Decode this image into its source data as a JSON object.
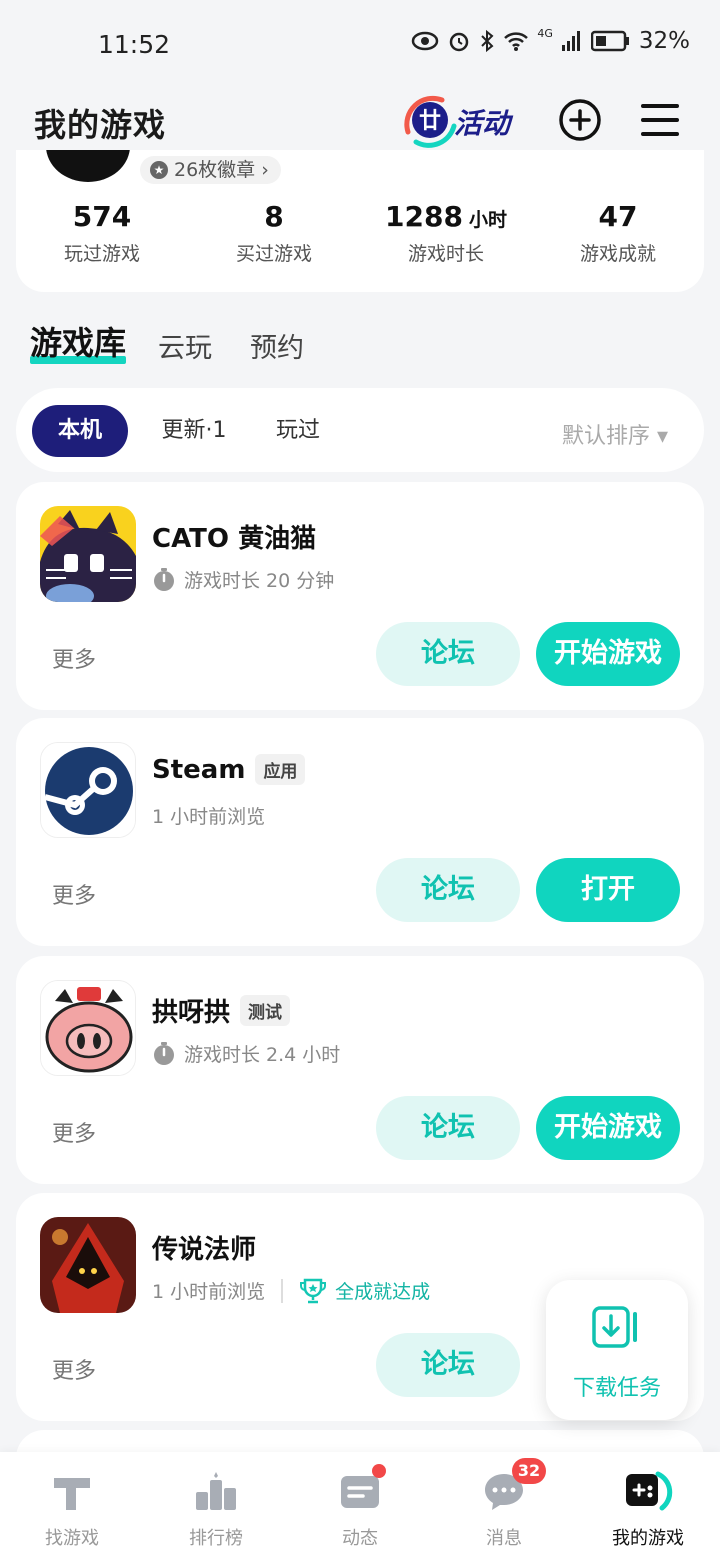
{
  "status_bar": {
    "time": "11:52",
    "network": "4G",
    "battery": "32%"
  },
  "header": {
    "title": "我的游戏",
    "activity_label": "活动",
    "add_icon": "plus-circle-icon",
    "menu_icon": "hamburger-menu-icon"
  },
  "profile": {
    "badges": "26枚徽章 ›"
  },
  "stats": [
    {
      "value": "574",
      "unit": "",
      "label": "玩过游戏"
    },
    {
      "value": "8",
      "unit": "",
      "label": "买过游戏"
    },
    {
      "value": "1288",
      "unit": "小时",
      "label": "游戏时长"
    },
    {
      "value": "47",
      "unit": "",
      "label": "游戏成就"
    }
  ],
  "main_tabs": [
    "游戏库",
    "云玩",
    "预约"
  ],
  "filters": {
    "items": [
      "本机",
      "更新·1",
      "玩过"
    ],
    "sort": "默认排序 ▾"
  },
  "games": [
    {
      "name": "CATO 黄油猫",
      "tag": "",
      "meta": "游戏时长 20 分钟",
      "more": "更多",
      "forum": "论坛",
      "action": "开始游戏"
    },
    {
      "name": "Steam",
      "tag": "应用",
      "meta": "1 小时前浏览",
      "more": "更多",
      "forum": "论坛",
      "action": "打开"
    },
    {
      "name": "拱呀拱",
      "tag": "测试",
      "meta": "游戏时长 2.4 小时",
      "more": "更多",
      "forum": "论坛",
      "action": "开始游戏"
    },
    {
      "name": "传说法师",
      "tag": "",
      "meta": "1 小时前浏览",
      "achievement": "全成就达成",
      "more": "更多",
      "forum": "论坛",
      "action": ""
    }
  ],
  "download_task": {
    "label": "下载任务"
  },
  "bottom_nav": [
    {
      "label": "找游戏",
      "icon": "find-game-icon"
    },
    {
      "label": "排行榜",
      "icon": "leaderboard-icon"
    },
    {
      "label": "动态",
      "icon": "feed-icon"
    },
    {
      "label": "消息",
      "icon": "message-icon",
      "badge": "32"
    },
    {
      "label": "我的游戏",
      "icon": "my-games-icon"
    }
  ],
  "colors": {
    "accent": "#10d5bf",
    "accent_light": "#e0f7f4",
    "active_chip": "#1e1e7a",
    "badge_red": "#f24848"
  }
}
